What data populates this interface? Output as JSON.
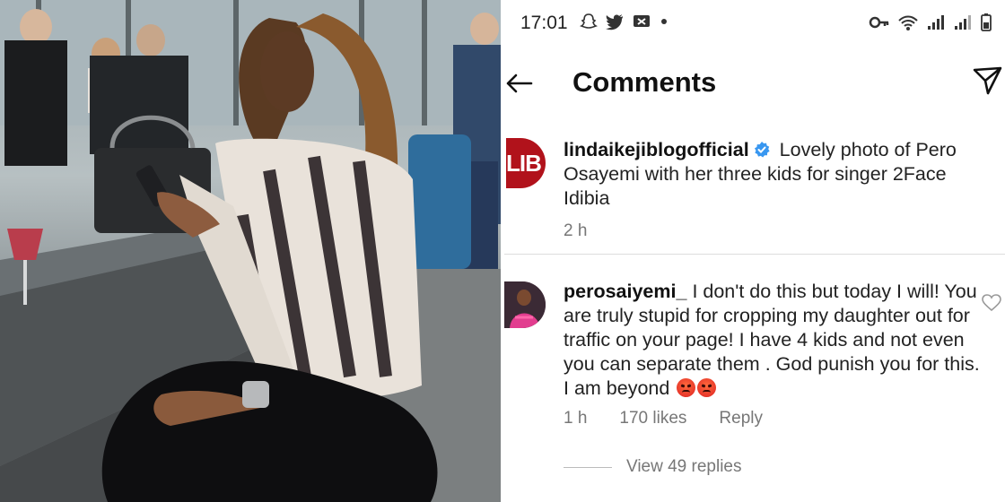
{
  "statusbar": {
    "time": "17:01"
  },
  "header": {
    "title": "Comments"
  },
  "caption": {
    "username": "lindaikejiblogofficial",
    "avatar_text": "LIB",
    "text": "Lovely photo of Pero Osayemi with her three kids for singer 2Face Idibia",
    "time": "2 h"
  },
  "reply": {
    "username": "perosaiyemi_",
    "text": "I don't do this but today I will! You are truly stupid for cropping my daughter out for traffic on your page! I have 4 kids and not even you can separate them . God punish you for this. I am beyond",
    "time": "1 h",
    "likes": "170 likes",
    "reply_label": "Reply",
    "emoji": "pouting-face-emoji"
  },
  "view_replies": {
    "label": "View 49 replies"
  },
  "colors": {
    "lib_red": "#b1121b",
    "verified_blue": "#3897f0",
    "meta_gray": "#777777"
  }
}
